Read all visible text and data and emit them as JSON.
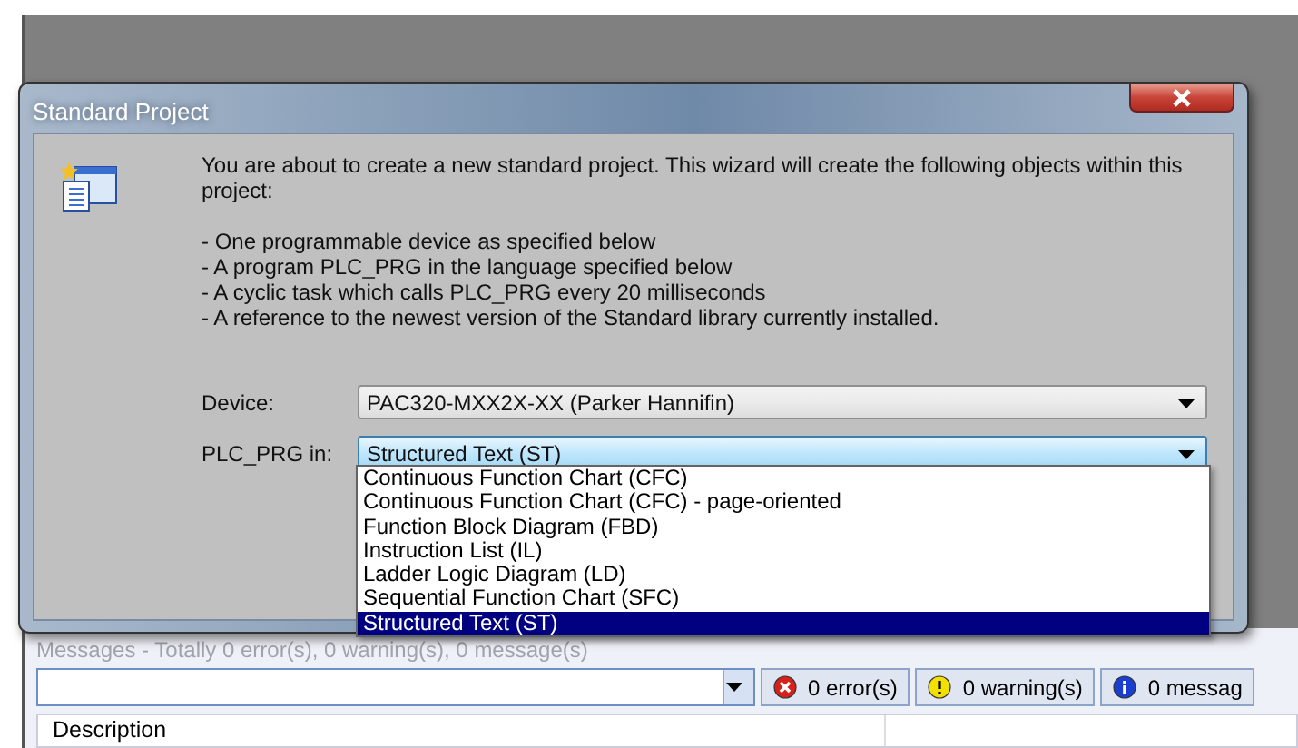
{
  "dialog": {
    "title": "Standard Project",
    "intro": "You are about to create a new standard project. This wizard will create the following objects within this project:",
    "bullets": [
      "- One programmable device as specified below",
      "- A program PLC_PRG in the language specified below",
      "- A cyclic task which calls PLC_PRG every 20 milliseconds",
      "- A reference to the newest version of the Standard library currently installed."
    ],
    "fields": [
      {
        "label": "Device:",
        "value": "PAC320-MXX2X-XX (Parker Hannifin)",
        "focused": false
      },
      {
        "label": "PLC_PRG in:",
        "value": "Structured Text (ST)",
        "focused": true
      }
    ],
    "options": [
      {
        "label": "Continuous Function Chart (CFC)",
        "selected": false
      },
      {
        "label": "Continuous Function Chart (CFC) - page-oriented",
        "selected": false
      },
      {
        "label": "Function Block Diagram (FBD)",
        "selected": false
      },
      {
        "label": "Instruction List (IL)",
        "selected": false
      },
      {
        "label": "Ladder Logic Diagram (LD)",
        "selected": false
      },
      {
        "label": "Sequential Function Chart (SFC)",
        "selected": false
      },
      {
        "label": "Structured Text (ST)",
        "selected": true
      }
    ]
  },
  "messages": {
    "title": "Messages - Totally 0 error(s), 0 warning(s), 0 message(s)",
    "counters": [
      {
        "kind": "error",
        "label": "0 error(s)"
      },
      {
        "kind": "warning",
        "label": "0 warning(s)"
      },
      {
        "kind": "info",
        "label": "0 messag"
      }
    ],
    "columns": [
      "Description"
    ]
  }
}
